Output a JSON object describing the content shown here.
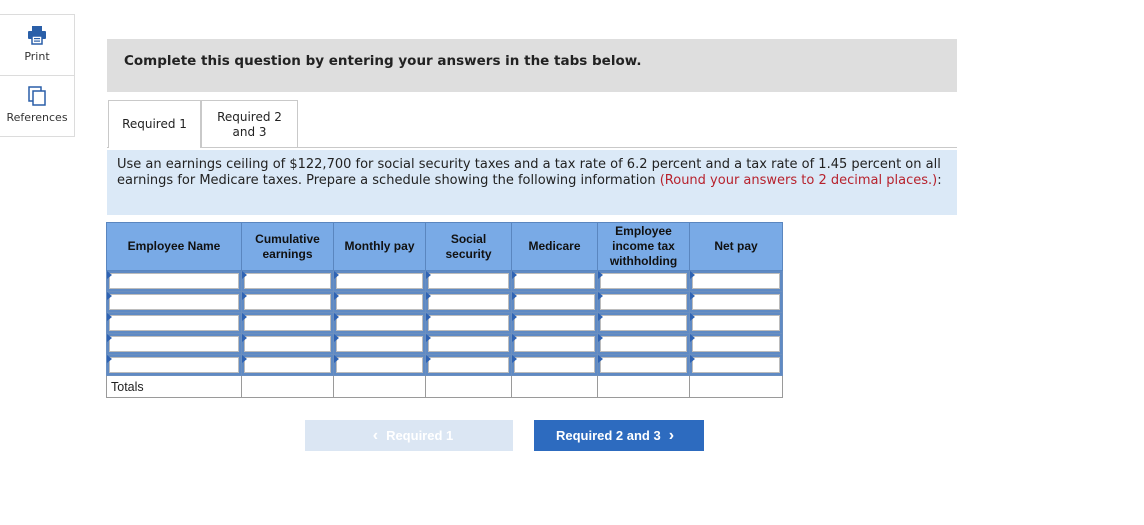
{
  "sidebar": {
    "print_label": "Print",
    "references_label": "References"
  },
  "banner": {
    "text": "Complete this question by entering your answers in the tabs below."
  },
  "tabs": [
    {
      "label": "Required 1",
      "active": true
    },
    {
      "label": "Required 2 and 3",
      "active": false
    }
  ],
  "question": {
    "text": "Use an earnings ceiling of $122,700 for social security taxes and a tax rate of 6.2 percent and a tax rate of 1.45 percent on all earnings for Medicare taxes. Prepare a schedule showing the following information ",
    "note": "(Round your answers to 2 decimal places.)",
    "suffix": ":"
  },
  "table": {
    "headers": [
      "Employee Name",
      "Cumulative earnings",
      "Monthly pay",
      "Social security",
      "Medicare",
      "Employee income tax withholding",
      "Net pay"
    ],
    "rows": [
      [
        "",
        "",
        "",
        "",
        "",
        "",
        ""
      ],
      [
        "",
        "",
        "",
        "",
        "",
        "",
        ""
      ],
      [
        "",
        "",
        "",
        "",
        "",
        "",
        ""
      ],
      [
        "",
        "",
        "",
        "",
        "",
        "",
        ""
      ],
      [
        "",
        "",
        "",
        "",
        "",
        "",
        ""
      ]
    ],
    "totals_label": "Totals"
  },
  "nav": {
    "prev_label": "Required 1",
    "next_label": "Required 2 and 3"
  },
  "colors": {
    "header_bg": "#79aae6",
    "banner_bg": "#dedede",
    "question_bg": "#dbe9f7",
    "note_red": "#b7222d",
    "next_button": "#2d6bbf",
    "prev_button_disabled": "#dbe6f3"
  },
  "icons": {
    "print": "printer-icon",
    "references": "copy-documents-icon",
    "prev": "chevron-left-icon",
    "next": "chevron-right-icon"
  }
}
